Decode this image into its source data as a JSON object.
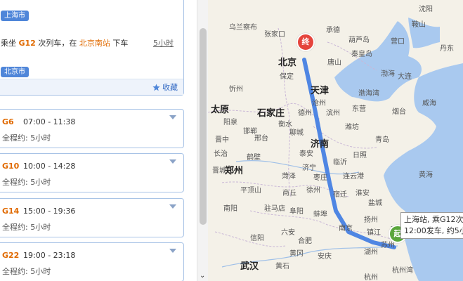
{
  "route": {
    "start_tag": "上海市",
    "step": {
      "prefix": "乘坐",
      "train": "G12",
      "middle": "次列车，在",
      "station": "北京南站",
      "suffix": "下车",
      "duration": "5小时"
    },
    "end_tag": "北京市",
    "favorite": "收藏"
  },
  "trains": [
    {
      "code": "G6",
      "time": "07:00 - 11:38",
      "total": "全程约: 5小时"
    },
    {
      "code": "G10",
      "time": "10:00 - 14:28",
      "total": "全程约: 5小时"
    },
    {
      "code": "G14",
      "time": "15:00 - 19:36",
      "total": "全程约: 5小时"
    },
    {
      "code": "G22",
      "time": "19:00 - 23:18",
      "total": "全程约: 5小时"
    }
  ],
  "map": {
    "cities": [
      "乌兰察布",
      "张家口",
      "承德",
      "北京",
      "唐山",
      "葫芦岛",
      "秦皇岛",
      "沈阳",
      "鞍山",
      "营口",
      "丹东",
      "大连",
      "保定",
      "天津",
      "沧州",
      "忻州",
      "太原",
      "石家庄",
      "衡水",
      "德州",
      "滨州",
      "东营",
      "烟台",
      "威海",
      "阳泉",
      "晋中",
      "邢台",
      "聊城",
      "邯郸",
      "潍坊",
      "长治",
      "济南",
      "青岛",
      "鹤壁",
      "泰安",
      "日照",
      "临沂",
      "晋城",
      "郑州",
      "济宁",
      "枣庄",
      "菏泽",
      "徐州",
      "连云港",
      "平顶山",
      "驻马店",
      "商丘",
      "宿迁",
      "淮安",
      "阜阳",
      "南阳",
      "蚌埠",
      "盐城",
      "黄海",
      "南京",
      "扬州",
      "合肥",
      "六安",
      "镇江",
      "南通",
      "苏州",
      "湖州",
      "杭州",
      "杭州湾",
      "信阳",
      "武汉",
      "黄石",
      "黄冈",
      "安庆",
      "渤海",
      "渤海湾",
      "北京",
      "天津",
      "济南",
      "石家庄",
      "南京"
    ],
    "route_line_color": "#4f86e3",
    "end_label": "终",
    "start_label": "起",
    "tooltip_line1": "上海站, 乘G12次",
    "tooltip_line2": "12:00发车, 约5小"
  }
}
